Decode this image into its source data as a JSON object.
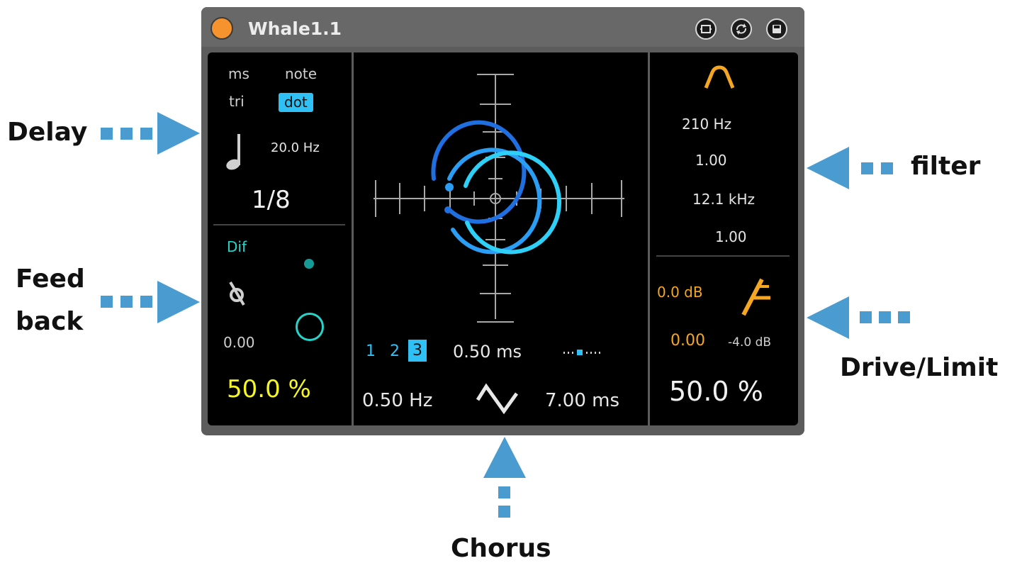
{
  "annotations": {
    "delay": "Delay",
    "feedback_line1": "Feed",
    "feedback_line2": "back",
    "filter": "filter",
    "drive_limit": "Drive/Limit",
    "chorus": "Chorus",
    "arrow_color": "#4a9bd0"
  },
  "device": {
    "title": "Whale1.1",
    "power_color": "#f7932f",
    "title_buttons": [
      "clip-icon",
      "hot-swap-icon",
      "save-preset-icon"
    ]
  },
  "delay": {
    "mode_ms": "ms",
    "mode_note": "note",
    "mode_tri": "tri",
    "mode_dot": "dot",
    "selected_mode": "dot",
    "note_icon": "quarter-note-icon",
    "rate": "20.0 Hz",
    "time": "1/8"
  },
  "feedback": {
    "dif_label": "Dif",
    "phase_icon": "phase-invert-icon",
    "value": "0.00",
    "amount": "50.0 %"
  },
  "chorus": {
    "voice_1": "1",
    "voice_2": "2",
    "voice_3": "3",
    "selected_voice": "3",
    "time": "0.50 ms",
    "rate": "0.50 Hz",
    "waveform_icon": "triangle-wave-icon",
    "depth": "7.00 ms"
  },
  "filter": {
    "type_icon": "bandpass-icon",
    "low_freq": "210 Hz",
    "low_q": "1.00",
    "high_freq": "12.1 kHz",
    "high_q": "1.00"
  },
  "drive": {
    "gain": "0.0 dB",
    "limit_icon": "limiter-icon",
    "drive_value": "0.00",
    "threshold": "-4.0 dB",
    "dry_wet": "50.0 %"
  },
  "colors": {
    "accent_blue": "#2fc1f5",
    "accent_orange": "#f5a623",
    "accent_yellow": "#f5f523",
    "accent_teal": "#26d3c9"
  }
}
